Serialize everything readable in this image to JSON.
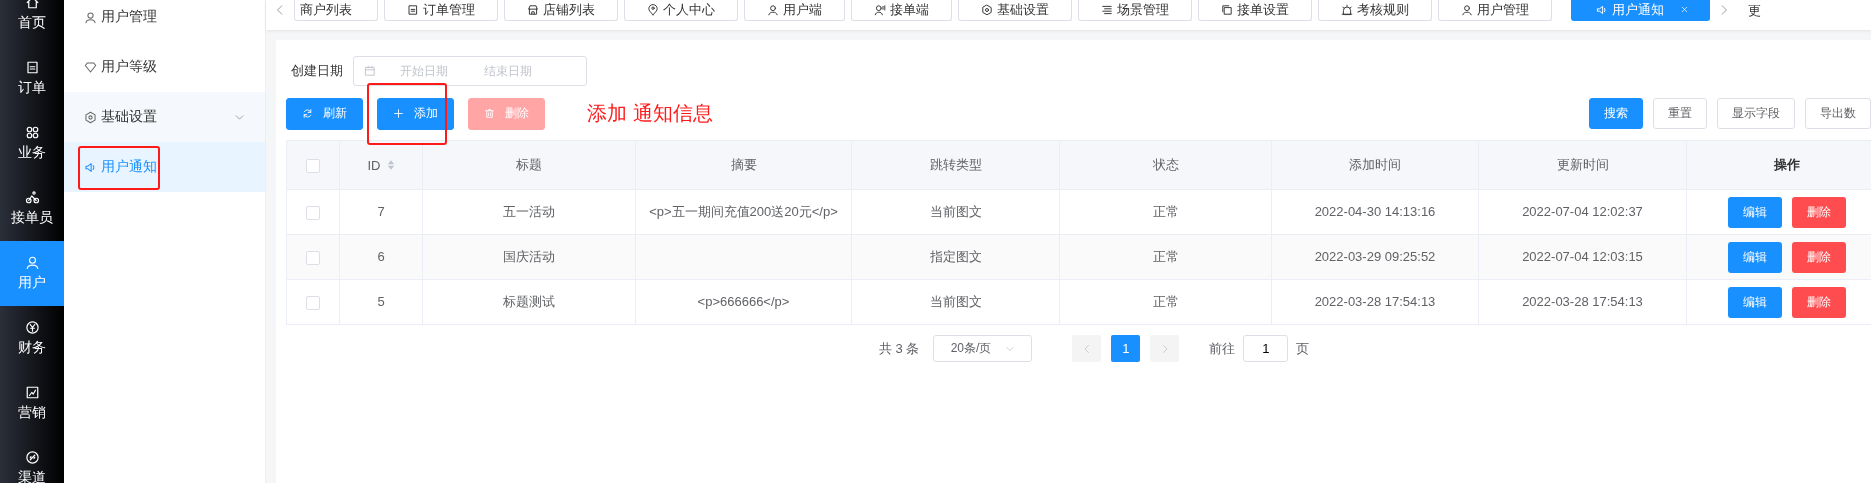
{
  "rail": [
    {
      "label": "首页",
      "selected": false
    },
    {
      "label": "订单",
      "selected": false
    },
    {
      "label": "业务",
      "selected": false
    },
    {
      "label": "接单员",
      "selected": false
    },
    {
      "label": "用户",
      "selected": true
    },
    {
      "label": "财务",
      "selected": false
    },
    {
      "label": "营销",
      "selected": false
    },
    {
      "label": "渠道",
      "selected": false
    }
  ],
  "subnav": [
    {
      "label": "用户管理",
      "selected": false,
      "annotated": false
    },
    {
      "label": "用户等级",
      "selected": false,
      "annotated": false
    },
    {
      "label": "基础设置",
      "expanded": true,
      "children": [
        {
          "label": "用户通知",
          "selected": true,
          "annotated": true
        }
      ]
    }
  ],
  "tabs": [
    {
      "label": "商户列表",
      "selected": false
    },
    {
      "label": "订单管理",
      "selected": false
    },
    {
      "label": "店铺列表",
      "selected": false
    },
    {
      "label": "个人中心",
      "selected": false
    },
    {
      "label": "用户端",
      "selected": false
    },
    {
      "label": "接单端",
      "selected": false
    },
    {
      "label": "基础设置",
      "selected": false
    },
    {
      "label": "场景管理",
      "selected": false
    },
    {
      "label": "接单设置",
      "selected": false
    },
    {
      "label": "考核规则",
      "selected": false
    },
    {
      "label": "用户管理",
      "selected": false
    },
    {
      "label": "用户通知",
      "selected": true
    }
  ],
  "tabs_overflow": "更",
  "filter": {
    "label": "创建日期",
    "start": {
      "placeholder": "开始日期"
    },
    "end": {
      "placeholder": "结束日期"
    }
  },
  "toolbar_left": [
    {
      "label": "刷新",
      "kind": "primary",
      "disabled": false,
      "annotated": false
    },
    {
      "label": "添加",
      "kind": "primary",
      "disabled": false,
      "annotated": true
    },
    {
      "label": "删除",
      "kind": "danger",
      "disabled": true,
      "annotated": false
    }
  ],
  "annotation": "添加 通知信息",
  "toolbar_right": [
    {
      "label": "搜索",
      "kind": "primary"
    },
    {
      "label": "重置",
      "kind": "default"
    },
    {
      "label": "显示字段",
      "kind": "default"
    },
    {
      "label": "导出数",
      "kind": "default"
    }
  ],
  "table": {
    "header_checked": false,
    "columns": [
      {
        "label": "ID",
        "sortable": true
      },
      {
        "label": "标题",
        "sortable": false
      },
      {
        "label": "摘要",
        "sortable": false
      },
      {
        "label": "跳转类型",
        "sortable": false
      },
      {
        "label": "状态",
        "sortable": false
      },
      {
        "label": "添加时间",
        "sortable": false
      },
      {
        "label": "更新时间",
        "sortable": false
      },
      {
        "label": "操作",
        "sortable": false
      }
    ],
    "rows": [
      {
        "checked": false,
        "id": "7",
        "title": "五一活动",
        "summary": "<p>五一期间充值200送20元</p>",
        "jump_type": "当前图文",
        "status": "正常",
        "added": "2022-04-30 14:13:16",
        "updated": "2022-07-04 12:02:37",
        "actions": [
          "编辑",
          "删除"
        ]
      },
      {
        "checked": false,
        "id": "6",
        "title": "国庆活动",
        "jump_type": "指定图文",
        "status": "正常",
        "added": "2022-03-29 09:25:52",
        "updated": "2022-07-04 12:03:15",
        "actions": [
          "编辑",
          "删除"
        ]
      },
      {
        "checked": false,
        "id": "5",
        "title": "标题测试",
        "summary": "<p>666666</p>",
        "jump_type": "当前图文",
        "status": "正常",
        "added": "2022-03-28 17:54:13",
        "updated": "2022-03-28 17:54:13",
        "actions": [
          "编辑",
          "删除"
        ]
      }
    ]
  },
  "pagination": {
    "total": "共 3 条",
    "page_size": "20条/页",
    "pages": [
      {
        "label": "1",
        "selected": true
      }
    ],
    "goto_label": "前往",
    "goto_value": "1",
    "goto_suffix": "页"
  }
}
